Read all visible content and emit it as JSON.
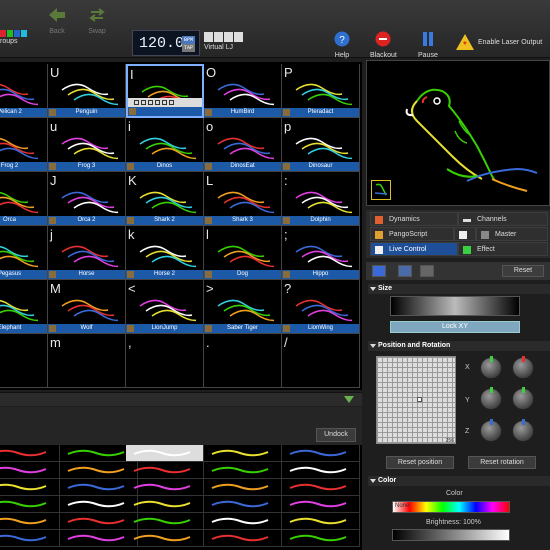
{
  "toolbar": {
    "groups_label": "roups",
    "back_label": "Back",
    "swap_label": "Swap",
    "bpm_value": "120.0",
    "bpm_tag": "BPM",
    "bpm_tag2": "TAP",
    "virtual_lj_label": "Virtual LJ",
    "help_label": "Help",
    "blackout_label": "Blackout",
    "pause_label": "Pause",
    "enable_laser_label": "Enable Laser Output"
  },
  "grid": {
    "rows": [
      [
        {
          "key": "",
          "label": "Pelican 2"
        },
        {
          "key": "U",
          "label": "Penguin"
        },
        {
          "key": "I",
          "label": ""
        },
        {
          "key": "O",
          "label": "HumBird"
        },
        {
          "key": "P",
          "label": "Pteradact"
        }
      ],
      [
        {
          "key": "",
          "label": "Frog 2"
        },
        {
          "key": "u",
          "label": "Frog 3"
        },
        {
          "key": "i",
          "label": "Dinos"
        },
        {
          "key": "o",
          "label": "DinosEat"
        },
        {
          "key": "p",
          "label": "Dinosaur"
        }
      ],
      [
        {
          "key": "",
          "label": "Orca"
        },
        {
          "key": "J",
          "label": "Orca 2"
        },
        {
          "key": "K",
          "label": "Shark 2"
        },
        {
          "key": "L",
          "label": "Shark 3"
        },
        {
          "key": ":",
          "label": "Dolphin"
        }
      ],
      [
        {
          "key": "",
          "label": "Pegasus"
        },
        {
          "key": "j",
          "label": "Horse"
        },
        {
          "key": "k",
          "label": "Horse 2"
        },
        {
          "key": "l",
          "label": "Dog"
        },
        {
          "key": ";",
          "label": "Hippo"
        }
      ],
      [
        {
          "key": "",
          "label": "Elephant"
        },
        {
          "key": "M",
          "label": "Wolf"
        },
        {
          "key": "<",
          "label": "LionJump"
        },
        {
          "key": ">",
          "label": "Saber Tiger"
        },
        {
          "key": "?",
          "label": "LionWing"
        }
      ],
      [
        {
          "key": "",
          "label": ""
        },
        {
          "key": "m",
          "label": ""
        },
        {
          "key": ",",
          "label": ""
        },
        {
          "key": ".",
          "label": ""
        },
        {
          "key": "/",
          "label": ""
        }
      ]
    ]
  },
  "lower": {
    "undock_label": "Undock"
  },
  "tabs": {
    "dynamics": "Dynamics",
    "channels": "Channels",
    "pangoscript": "PangoScript",
    "master": "Master",
    "live_control": "Live Control",
    "effect": "Effect"
  },
  "live_control": {
    "reset_label": "Reset",
    "size_section": "Size",
    "lock_xy_label": "Lock XY",
    "position_section": "Position and Rotation",
    "x_label": "X",
    "y_label": "Y",
    "z_label": "Z",
    "grid_value_label": "256",
    "reset_position_label": "Reset position",
    "reset_rotation_label": "Reset rotation",
    "color_section": "Color",
    "color_label": "Color",
    "color_value": "None",
    "brightness_label": "Brightness: 100%"
  },
  "colors": {
    "accent": "#1f4f99",
    "label_bg": "#1c5aa8",
    "selected_border": "#7fb0ff"
  }
}
